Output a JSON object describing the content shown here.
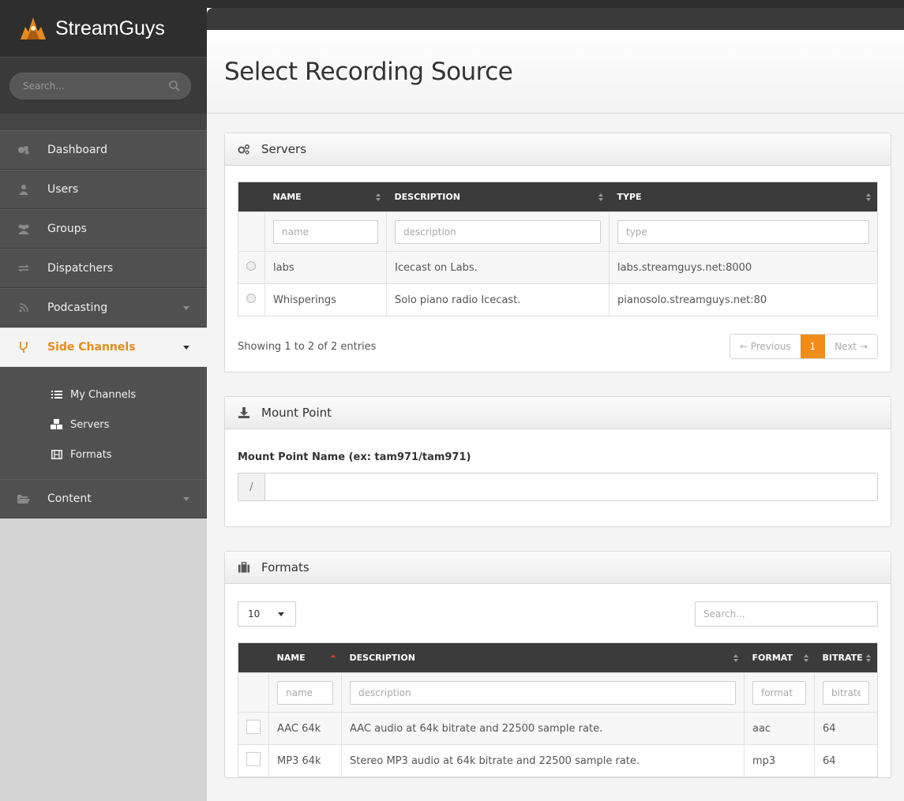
{
  "app": {
    "brand": "StreamGuys"
  },
  "search": {
    "placeholder": "Search..."
  },
  "sidebar": {
    "items": [
      {
        "label": "Dashboard"
      },
      {
        "label": "Users"
      },
      {
        "label": "Groups"
      },
      {
        "label": "Dispatchers"
      },
      {
        "label": "Podcasting"
      },
      {
        "label": "Side Channels"
      },
      {
        "label": "Content"
      }
    ],
    "subitems": [
      {
        "label": "My Channels"
      },
      {
        "label": "Servers"
      },
      {
        "label": "Formats"
      }
    ]
  },
  "page": {
    "title": "Select Recording Source"
  },
  "servers": {
    "heading": "Servers",
    "columns": [
      "NAME",
      "DESCRIPTION",
      "TYPE"
    ],
    "filters": {
      "name": "name",
      "description": "description",
      "type": "type"
    },
    "rows": [
      {
        "name": "labs",
        "description": "Icecast on Labs.",
        "type": "labs.streamguys.net:8000"
      },
      {
        "name": "Whisperings",
        "description": "Solo piano radio Icecast.",
        "type": "pianosolo.streamguys.net:80"
      }
    ],
    "info": "Showing 1 to 2 of 2 entries",
    "pager": {
      "prev": "← Previous",
      "current": "1",
      "next": "Next →"
    }
  },
  "mount": {
    "heading": "Mount Point",
    "label": "Mount Point Name (ex: tam971/tam971)",
    "prefix": "/",
    "value": ""
  },
  "formats": {
    "heading": "Formats",
    "page_size": "10",
    "search_placeholder": "Search...",
    "columns": [
      "NAME",
      "DESCRIPTION",
      "FORMAT",
      "BITRATE"
    ],
    "filters": {
      "name": "name",
      "description": "description",
      "format": "format",
      "bitrate": "bitrate"
    },
    "rows": [
      {
        "name": "AAC 64k",
        "description": "AAC audio at 64k bitrate and 22500 sample rate.",
        "format": "aac",
        "bitrate": "64"
      },
      {
        "name": "MP3 64k",
        "description": "Stereo MP3 audio at 64k bitrate and 22500 sample rate.",
        "format": "mp3",
        "bitrate": "64"
      }
    ]
  },
  "colors": {
    "accent": "#f08c1a",
    "sidebar": "#505050",
    "header_dark": "#3b3b3b"
  }
}
